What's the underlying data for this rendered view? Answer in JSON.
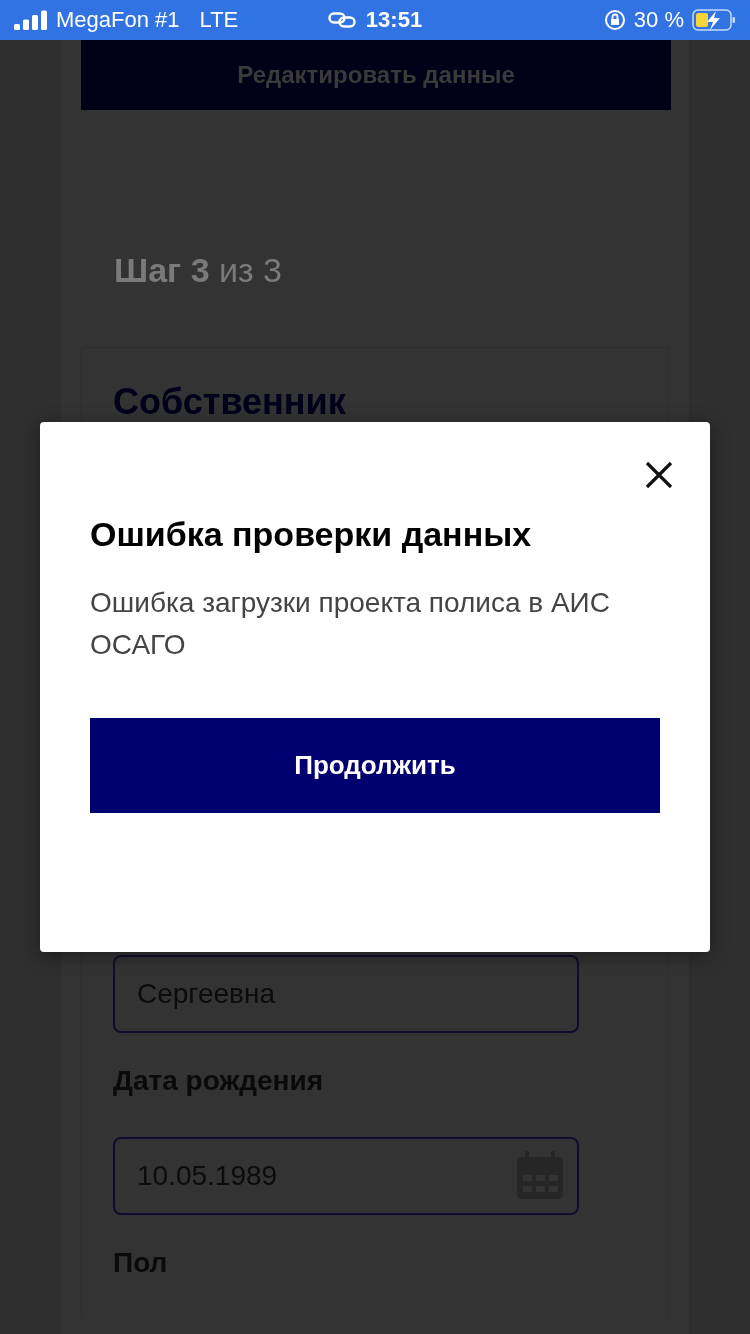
{
  "status_bar": {
    "carrier": "MegaFon #1",
    "network": "LTE",
    "time": "13:51",
    "battery": "30 %"
  },
  "page": {
    "edit_button": "Редактировать данные",
    "step": "**Шаг 3** из 3",
    "card_title": "Собственник",
    "items": [
      {
        "kind": "input",
        "value": "Сергеевна"
      },
      {
        "kind": "label",
        "text": "Дата рождения"
      },
      {
        "kind": "date",
        "value": "10.05.1989"
      },
      {
        "kind": "label",
        "text": "Пол"
      }
    ]
  },
  "modal": {
    "title": "Ошибка проверки данных",
    "message": "Ошибка загрузки проекта полиса в АИС ОСАГО",
    "button": "Продолжить"
  }
}
